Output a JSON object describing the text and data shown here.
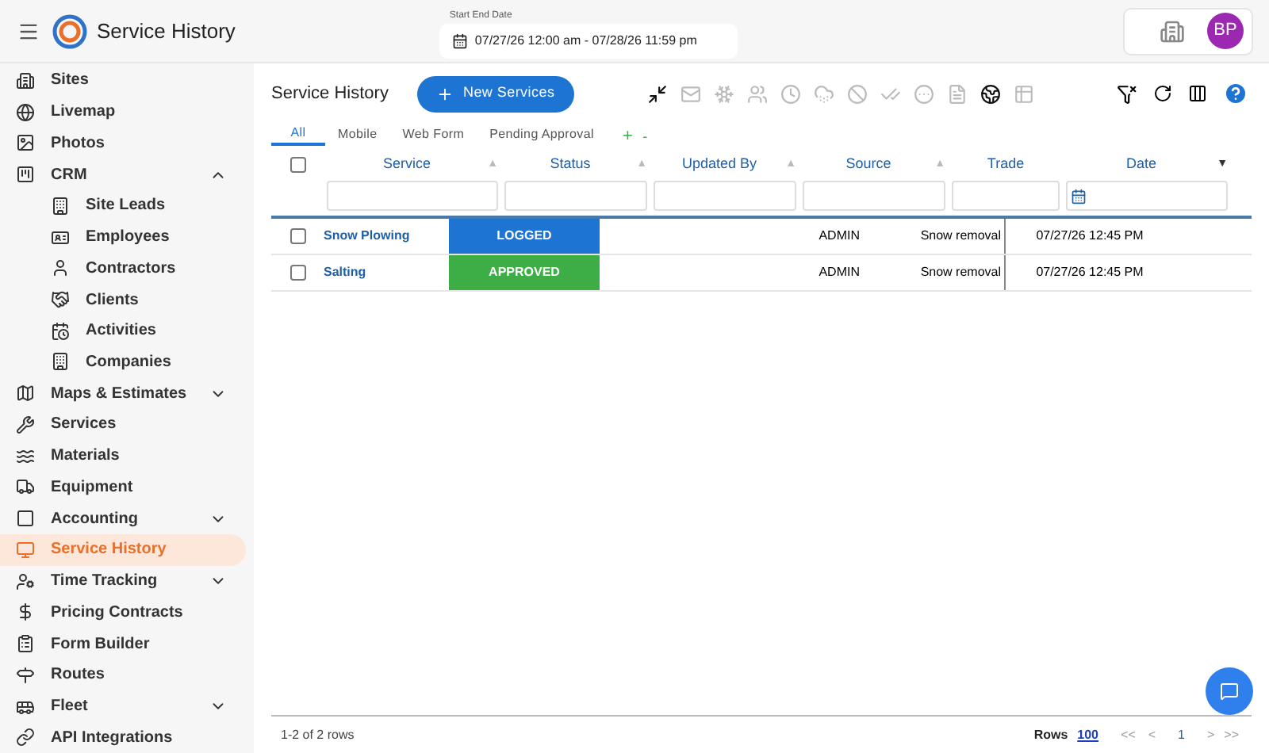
{
  "header": {
    "title": "Service History",
    "date_range": {
      "label": "Start End Date",
      "value": "07/27/26 12:00 am - 07/28/26 11:59 pm"
    },
    "avatar": "BP"
  },
  "sidebar": {
    "items": [
      {
        "label": "Sites",
        "selected": false
      },
      {
        "label": "Livemap",
        "selected": false
      },
      {
        "label": "Photos",
        "selected": false
      },
      {
        "label": "CRM",
        "selected": false,
        "expanded": true,
        "children": [
          {
            "label": "Site Leads",
            "selected": false
          },
          {
            "label": "Employees",
            "selected": false
          },
          {
            "label": "Contractors",
            "selected": false
          },
          {
            "label": "Clients",
            "selected": false
          },
          {
            "label": "Activities",
            "selected": false
          },
          {
            "label": "Companies",
            "selected": false
          }
        ]
      },
      {
        "label": "Maps & Estimates",
        "selected": false,
        "expanded": false
      },
      {
        "label": "Services",
        "selected": false
      },
      {
        "label": "Materials",
        "selected": false
      },
      {
        "label": "Equipment",
        "selected": false
      },
      {
        "label": "Accounting",
        "selected": false,
        "expanded": false
      },
      {
        "label": "Service History",
        "selected": true
      },
      {
        "label": "Time Tracking",
        "selected": false,
        "expanded": false
      },
      {
        "label": "Pricing Contracts",
        "selected": false
      },
      {
        "label": "Form Builder",
        "selected": false
      },
      {
        "label": "Routes",
        "selected": false
      },
      {
        "label": "Fleet",
        "selected": false,
        "expanded": false
      },
      {
        "label": "API Integrations",
        "selected": false
      }
    ]
  },
  "panel": {
    "title": "Service History",
    "new_button": "New Services",
    "toolbar": [
      {
        "disabled": false
      },
      {
        "disabled": true
      },
      {
        "disabled": true
      },
      {
        "disabled": true
      },
      {
        "disabled": true
      },
      {
        "disabled": true
      },
      {
        "disabled": true
      },
      {
        "disabled": true
      },
      {
        "disabled": true
      },
      {
        "disabled": true
      },
      {
        "disabled": false
      },
      {
        "disabled": true
      }
    ],
    "tabs": [
      {
        "label": "All",
        "selected": true
      },
      {
        "label": "Mobile",
        "selected": false
      },
      {
        "label": "Web Form",
        "selected": false
      },
      {
        "label": "Pending Approval",
        "selected": false
      }
    ],
    "tab_add": "+",
    "tab_remove": "-",
    "table": {
      "select_all": {
        "checked": false
      },
      "columns": [
        {
          "label": "Service",
          "sort": "▲",
          "active": false
        },
        {
          "label": "Status",
          "sort": "▲",
          "active": false
        },
        {
          "label": "Updated By",
          "sort": "▲",
          "active": false
        },
        {
          "label": "Source",
          "sort": "▲",
          "active": false
        },
        {
          "label": "Trade"
        },
        {
          "label": "Date",
          "sort": "▼",
          "active": true
        }
      ],
      "rows": [
        {
          "checked": false,
          "service": "Snow Plowing",
          "status": {
            "label": "LOGGED",
            "color": "#1e74d2"
          },
          "source": "ADMIN",
          "trade": "Snow removal",
          "date": "07/27/26 12:45 PM"
        },
        {
          "checked": false,
          "service": "Salting",
          "status": {
            "label": "APPROVED",
            "color": "#3dae45"
          },
          "source": "ADMIN",
          "trade": "Snow removal",
          "date": "07/27/26 12:45 PM"
        }
      ]
    },
    "footer": {
      "summary": "1-2 of 2 rows",
      "rows_label": "Rows",
      "rows_value": "100",
      "first": "<<",
      "prev": "<",
      "page": "1",
      "next": ">",
      "last": ">>"
    }
  }
}
